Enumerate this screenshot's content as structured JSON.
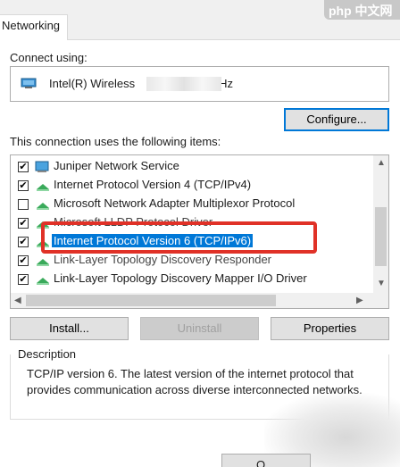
{
  "tab": {
    "label": "Networking"
  },
  "connect_using_label": "Connect using:",
  "adapter": {
    "name_left": "Intel(R) Wireless",
    "name_right": "Hz",
    "icon": "network-adapter-icon"
  },
  "configure_button": "Configure...",
  "items_label": "This connection uses the following items:",
  "items": [
    {
      "label": "Juniper Network Service",
      "checked": true,
      "icon": "network-service-icon"
    },
    {
      "label": "Internet Protocol Version 4 (TCP/IPv4)",
      "checked": true,
      "icon": "protocol-icon"
    },
    {
      "label": "Microsoft Network Adapter Multiplexor Protocol",
      "checked": false,
      "icon": "protocol-icon"
    },
    {
      "label": "Microsoft LLDP Protocol Driver",
      "checked": true,
      "icon": "protocol-icon"
    },
    {
      "label": "Internet Protocol Version 6 (TCP/IPv6)",
      "checked": true,
      "icon": "protocol-icon",
      "selected": true
    },
    {
      "label": "Link-Layer Topology Discovery Responder",
      "checked": true,
      "icon": "protocol-icon"
    },
    {
      "label": "Link-Layer Topology Discovery Mapper I/O Driver",
      "checked": true,
      "icon": "protocol-icon"
    }
  ],
  "buttons": {
    "install": "Install...",
    "uninstall": "Uninstall",
    "properties": "Properties"
  },
  "description": {
    "title": "Description",
    "text": "TCP/IP version 6. The latest version of the internet protocol that provides communication across diverse interconnected networks."
  },
  "bottom_button_partial": "O",
  "watermark": "php 中文网",
  "colors": {
    "accent": "#0078d7",
    "highlight_border": "#e03127",
    "window_bg": "#f0f0f0"
  }
}
